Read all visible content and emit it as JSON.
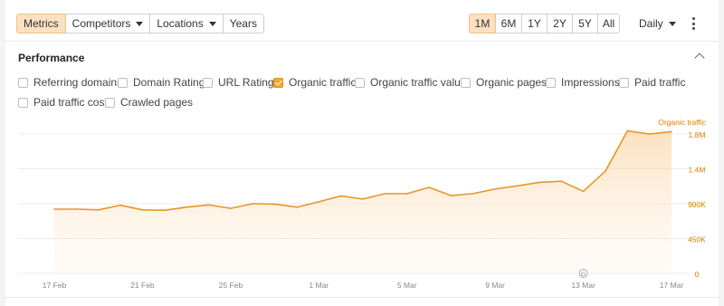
{
  "toolbar": {
    "metrics": "Metrics",
    "competitors": "Competitors",
    "locations": "Locations",
    "years": "Years"
  },
  "ranges": [
    "1M",
    "6M",
    "1Y",
    "2Y",
    "5Y",
    "All"
  ],
  "active_range": "1M",
  "interval": "Daily",
  "performance": {
    "title": "Performance",
    "metrics": [
      {
        "label": "Referring domains",
        "checked": false
      },
      {
        "label": "Domain Rating",
        "checked": false
      },
      {
        "label": "URL Rating",
        "checked": false
      },
      {
        "label": "Organic traffic",
        "checked": true
      },
      {
        "label": "Organic traffic value",
        "checked": false
      },
      {
        "label": "Organic pages",
        "checked": false
      },
      {
        "label": "Impressions",
        "checked": false
      },
      {
        "label": "Paid traffic",
        "checked": false
      },
      {
        "label": "Paid traffic cost",
        "checked": false
      },
      {
        "label": "Crawled pages",
        "checked": false
      }
    ]
  },
  "colors": {
    "accent": "#f5a623",
    "line": "#e8962a",
    "axis_text": "#e07b00",
    "date_text": "#888888"
  },
  "chart_data": {
    "type": "area",
    "series": [
      {
        "name": "Organic traffic",
        "values": [
          830000,
          830000,
          820000,
          880000,
          820000,
          815000,
          855000,
          885000,
          840000,
          900000,
          895000,
          855000,
          925000,
          1000000,
          960000,
          1030000,
          1030000,
          1110000,
          1005000,
          1030000,
          1090000,
          1130000,
          1175000,
          1190000,
          1060000,
          1320000,
          1840000,
          1800000,
          1830000
        ]
      }
    ],
    "x_tick_labels": [
      "17 Feb",
      "21 Feb",
      "25 Feb",
      "1 Mar",
      "5 Mar",
      "9 Mar",
      "13 Mar",
      "17 Mar"
    ],
    "y_tick_labels": [
      "0",
      "450K",
      "900K",
      "1.4M",
      "1.8M"
    ],
    "y_axis_label": "Organic traffic",
    "ylim": [
      0,
      1800000
    ],
    "grid": true,
    "annotation_marker": "G"
  }
}
